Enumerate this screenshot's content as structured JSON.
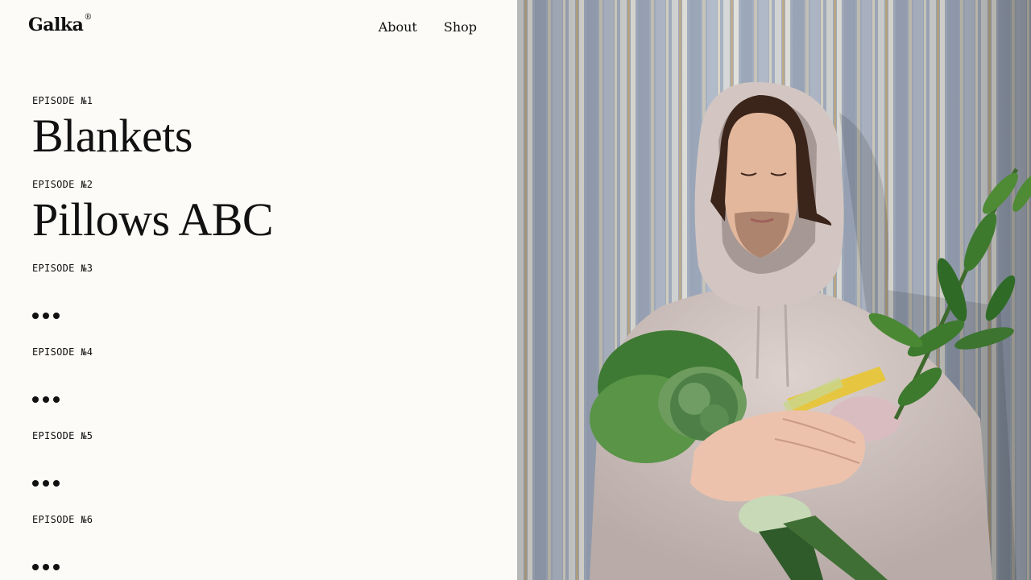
{
  "header": {
    "logo": "Galka",
    "logo_mark": "®",
    "nav": [
      {
        "label": "About"
      },
      {
        "label": "Shop"
      }
    ]
  },
  "episodes": [
    {
      "label": "EPISODE №1",
      "title": "Blankets"
    },
    {
      "label": "EPISODE №2",
      "title": "Pillows ABC"
    },
    {
      "label": "EPISODE №3",
      "title": ""
    },
    {
      "label": "EPISODE №4",
      "title": ""
    },
    {
      "label": "EPISODE №5",
      "title": ""
    },
    {
      "label": "EPISODE №6",
      "title": ""
    }
  ],
  "colors": {
    "background": "#fcfbf7",
    "text": "#111111",
    "hoodie": "#d9cdc9",
    "wallpaper": "#a9b3c3"
  },
  "hero_image": {
    "icon": "hero-photo"
  }
}
